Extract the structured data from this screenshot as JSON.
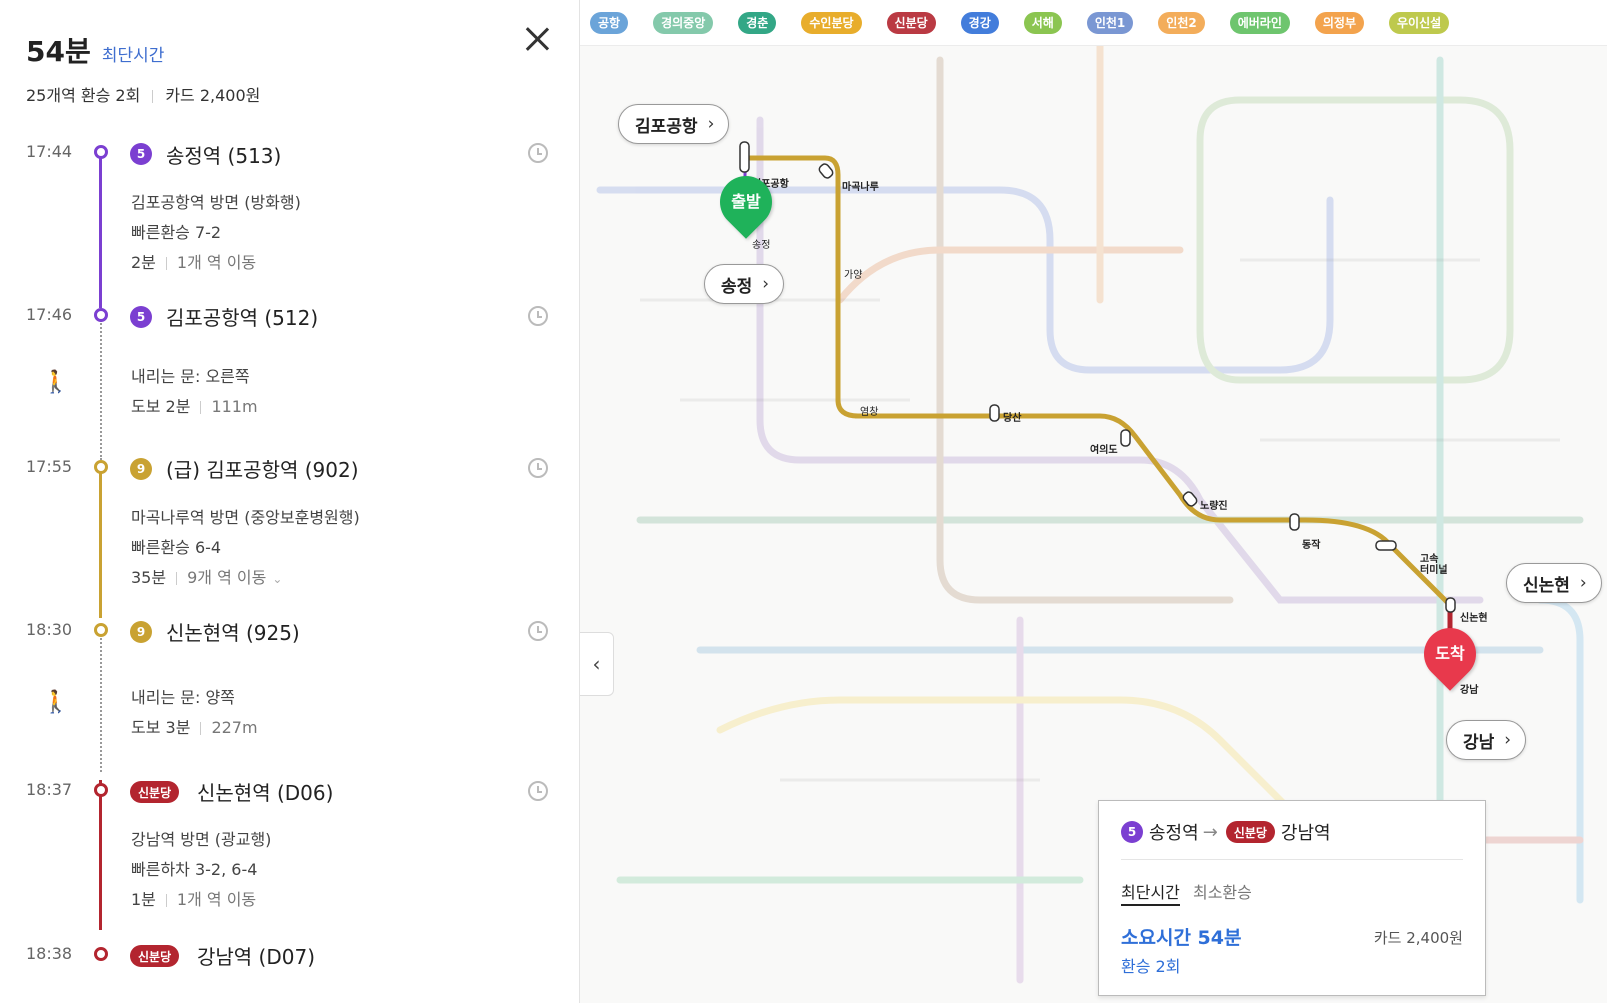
{
  "summary": {
    "duration": "54분",
    "duration_label": "최단시간",
    "stations": "25개역 환승 2회",
    "fare": "카드 2,400원"
  },
  "colors": {
    "line5": "#7b3fd1",
    "line9": "#c9a232",
    "shinbundang": "#b3252f",
    "start_pin": "#1fb25a",
    "end_pin": "#e8394c",
    "highlight": "#2f6fd8"
  },
  "steps": [
    {
      "time": "17:44",
      "badge": "5",
      "name": "송정역 (513)"
    },
    {
      "direction": "김포공항역 방면 (방화행)",
      "transfer": "빠른환승 7-2",
      "minutes": "2분",
      "stops": "1개 역 이동"
    },
    {
      "time": "17:46",
      "badge": "5",
      "name": "김포공항역 (512)"
    },
    {
      "door": "내리는 문: 오른쪽",
      "walk": "도보 2분",
      "distance": "111m"
    },
    {
      "time": "17:55",
      "badge": "9",
      "name": "(급) 김포공항역 (902)"
    },
    {
      "direction": "마곡나루역 방면 (중앙보훈병원행)",
      "transfer": "빠른환승 6-4",
      "minutes": "35분",
      "stops": "9개 역 이동"
    },
    {
      "time": "18:30",
      "badge": "9",
      "name": "신논현역 (925)"
    },
    {
      "door": "내리는 문: 양쪽",
      "walk": "도보 3분",
      "distance": "227m"
    },
    {
      "time": "18:37",
      "badge": "신분당",
      "name": "신논현역 (D06)"
    },
    {
      "direction": "강남역 방면 (광교행)",
      "transfer": "빠른하차 3-2, 6-4",
      "minutes": "1분",
      "stops": "1개 역 이동"
    },
    {
      "time": "18:38",
      "badge": "신분당",
      "name": "강남역 (D07)"
    }
  ],
  "line_filters": [
    {
      "label": "공항",
      "color": "#5b9bd5"
    },
    {
      "label": "경의중앙",
      "color": "#77c4a3"
    },
    {
      "label": "경춘",
      "color": "#1e9e7a"
    },
    {
      "label": "수인분당",
      "color": "#e6a516"
    },
    {
      "label": "신분당",
      "color": "#b3252f"
    },
    {
      "label": "경강",
      "color": "#2f6fd8"
    },
    {
      "label": "서해",
      "color": "#7fbf3f"
    },
    {
      "label": "인천1",
      "color": "#6c8ccf"
    },
    {
      "label": "인천2",
      "color": "#f2a54a"
    },
    {
      "label": "에버라인",
      "color": "#5fbf5f"
    },
    {
      "label": "의정부",
      "color": "#f29a3a"
    },
    {
      "label": "우이신설",
      "color": "#b7c43a"
    }
  ],
  "map": {
    "callouts": {
      "gimpo": "김포공항",
      "songjeong": "송정",
      "sinnonhyeon": "신논현",
      "gangnam": "강남"
    },
    "pins": {
      "start": "출발",
      "end": "도착"
    },
    "station_labels": [
      {
        "key": "gimpo_airport",
        "text": "김포공항"
      },
      {
        "key": "magongnaru",
        "text": "마곡나루"
      },
      {
        "key": "songjeong",
        "text": "송정"
      },
      {
        "key": "gayang",
        "text": "가양"
      },
      {
        "key": "yeomchang",
        "text": "염창"
      },
      {
        "key": "dangsan",
        "text": "당산"
      },
      {
        "key": "yeouido",
        "text": "여의도"
      },
      {
        "key": "noryangjin",
        "text": "노량진"
      },
      {
        "key": "dongjak",
        "text": "동작"
      },
      {
        "key": "express_terminal",
        "text": "고속\n터미널"
      },
      {
        "key": "sinnonhyeon",
        "text": "신논현"
      },
      {
        "key": "gangnam",
        "text": "강남"
      }
    ]
  },
  "card": {
    "from_badge": "5",
    "from": "송정역",
    "to_badge": "신분당",
    "to": "강남역",
    "tab_active": "최단시간",
    "tab_inactive": "최소환승",
    "duration": "소요시간 54분",
    "transfers": "환승 2회",
    "fare": "카드 2,400원"
  }
}
